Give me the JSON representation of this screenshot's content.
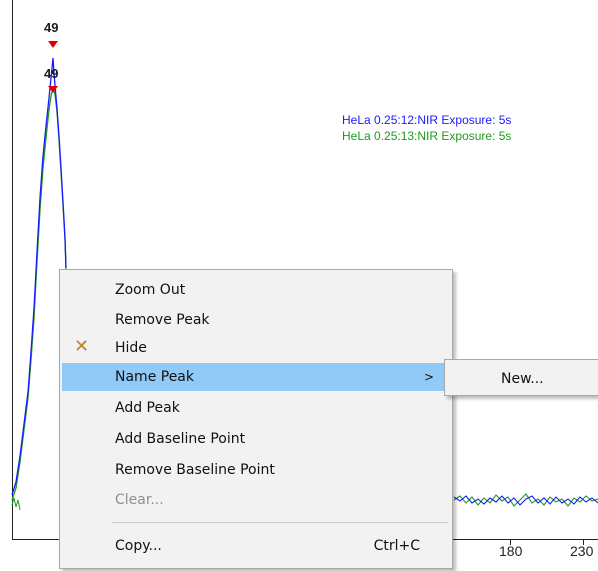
{
  "chart": {
    "peak_labels": [
      "49",
      "49"
    ],
    "legend": [
      {
        "text": "HeLa 0.25:12:NIR Exposure: 5s",
        "color": "#1a1aff"
      },
      {
        "text": "HeLa 0.25:13:NIR Exposure: 5s",
        "color": "#1f9a1f"
      }
    ],
    "x_tick_labels": [
      "180",
      "230"
    ],
    "colors": {
      "series_blue": "#1a1aff",
      "series_green": "#1f9a1f",
      "peak_marker": "#e00000"
    }
  },
  "context_menu": {
    "items": [
      {
        "label": "Zoom Out"
      },
      {
        "label": "Remove  Peak"
      },
      {
        "label": "Hide",
        "checked": true,
        "check_icon": "cross-check-icon"
      },
      {
        "label": "Name Peak",
        "submenu_arrow": ">",
        "highlighted": true
      },
      {
        "label": "Add Peak"
      },
      {
        "label": "Add Baseline Point"
      },
      {
        "label": "Remove Baseline Point"
      },
      {
        "label": "Clear...",
        "disabled": true
      },
      {
        "label": "Copy...",
        "shortcut": "Ctrl+C"
      }
    ]
  },
  "submenu": {
    "items": [
      {
        "label": "New..."
      }
    ]
  }
}
